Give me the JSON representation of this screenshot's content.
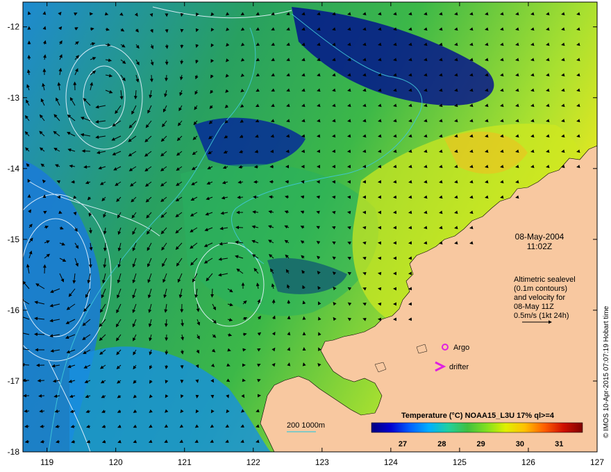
{
  "map": {
    "lon_ticks": [
      "119",
      "120",
      "121",
      "122",
      "123",
      "124",
      "125",
      "126",
      "127"
    ],
    "lat_ticks": [
      "-12",
      "-13",
      "-14",
      "-15",
      "-16",
      "-17",
      "-18"
    ],
    "lon_range": [
      118.65,
      127
    ],
    "lat_range": [
      -18,
      -11.65
    ]
  },
  "datetime": {
    "date": "08-May-2004",
    "time": "11:02Z"
  },
  "altimetry_note": {
    "lines": [
      "Altimetric sealevel",
      "(0.1m contours)",
      "and velocity for",
      "08-May 11Z",
      "0.5m/s (1kt 24h)"
    ]
  },
  "legend": {
    "argo_label": "Argo",
    "drifter_label": "drifter",
    "argo_color": "#e020e0",
    "drifter_color": "#e020e0"
  },
  "bathymetry": {
    "label": "200  1000m",
    "color": "#40c8d8"
  },
  "colorbar": {
    "title": "Temperature (°C) NOAA15_L3U 17% ql>=4",
    "ticks": [
      "27",
      "28",
      "29",
      "30",
      "31"
    ],
    "range": [
      26.2,
      31.6
    ],
    "colors": [
      "#000080",
      "#0000d0",
      "#0060ff",
      "#00b0ff",
      "#20d0a0",
      "#40c040",
      "#80e020",
      "#e0f000",
      "#ffc000",
      "#ff6000",
      "#d01000",
      "#800000"
    ]
  },
  "credit": "© IMOS 10-Apr-2015 07:07:19 Hobart time",
  "colors": {
    "land": "#f8c8a0",
    "sst_deep": "#000080",
    "sst_blue": "#2070d0",
    "sst_green": "#30b040",
    "sst_yellow": "#e8e820"
  }
}
